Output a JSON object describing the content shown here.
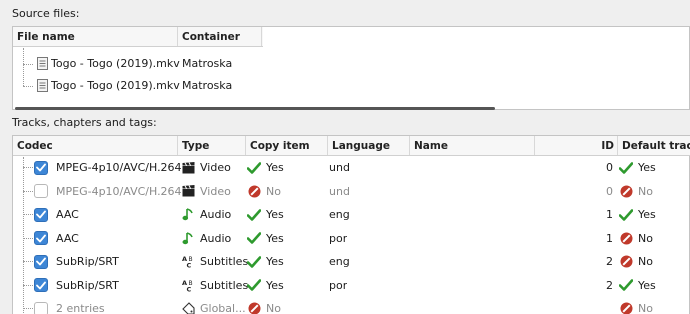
{
  "source_files": {
    "label": "Source files:",
    "columns": [
      "File name",
      "Container"
    ],
    "rows": [
      {
        "name": "Togo - Togo (2019).mkv",
        "container": "Matroska"
      },
      {
        "name": "Togo - Togo (2019).mkv",
        "container": "Matroska"
      }
    ]
  },
  "tracks": {
    "label": "Tracks, chapters and tags:",
    "columns": [
      "Codec",
      "Type",
      "Copy item",
      "Language",
      "Name",
      "ID",
      "Default track in"
    ],
    "rows": [
      {
        "checked": true,
        "codec": "MPEG-4p10/AVC/H.264",
        "type_icon": "video-clapper-icon",
        "type": "Video",
        "copy": "Yes",
        "copy_icon": "check-icon",
        "language": "und",
        "name": "",
        "id": "0",
        "default_icon": "check-icon",
        "default": "Yes",
        "muted": false
      },
      {
        "checked": false,
        "codec": "MPEG-4p10/AVC/H.264",
        "type_icon": "video-clapper-icon",
        "type": "Video",
        "copy": "No",
        "copy_icon": "no-icon",
        "language": "und",
        "name": "",
        "id": "0",
        "default_icon": "no-icon",
        "default": "No",
        "muted": true
      },
      {
        "checked": true,
        "codec": "AAC",
        "type_icon": "audio-note-icon",
        "type": "Audio",
        "copy": "Yes",
        "copy_icon": "check-icon",
        "language": "eng",
        "name": "",
        "id": "1",
        "default_icon": "check-icon",
        "default": "Yes",
        "muted": false
      },
      {
        "checked": true,
        "codec": "AAC",
        "type_icon": "audio-note-icon",
        "type": "Audio",
        "copy": "Yes",
        "copy_icon": "check-icon",
        "language": "por",
        "name": "",
        "id": "1",
        "default_icon": "no-icon",
        "default": "No",
        "muted": false
      },
      {
        "checked": true,
        "codec": "SubRip/SRT",
        "type_icon": "subtitles-icon",
        "type": "Subtitles",
        "copy": "Yes",
        "copy_icon": "check-icon",
        "language": "eng",
        "name": "",
        "id": "2",
        "default_icon": "no-icon",
        "default": "No",
        "muted": false
      },
      {
        "checked": true,
        "codec": "SubRip/SRT",
        "type_icon": "subtitles-icon",
        "type": "Subtitles",
        "copy": "Yes",
        "copy_icon": "check-icon",
        "language": "por",
        "name": "",
        "id": "2",
        "default_icon": "check-icon",
        "default": "Yes",
        "muted": false
      },
      {
        "checked": false,
        "codec": "2 entries",
        "type_icon": "tag-icon",
        "type": "Global...",
        "copy": "No",
        "copy_icon": "no-icon",
        "language": "",
        "name": "",
        "id": "",
        "default_icon": "no-icon",
        "default": "No",
        "muted": true
      }
    ]
  },
  "colors": {
    "check": "#2e9a2e",
    "no": "#c0392b",
    "checkbox": "#3d86d6"
  }
}
